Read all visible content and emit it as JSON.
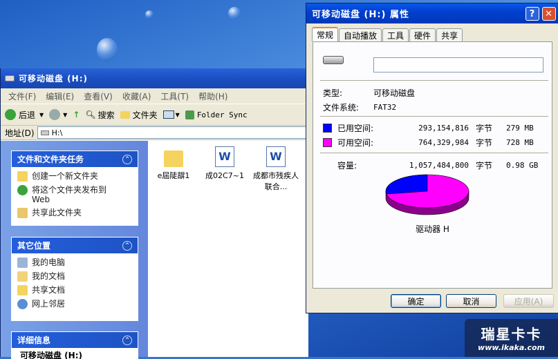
{
  "explorer": {
    "title": "可移动磁盘 (H:)",
    "menu": [
      "文件(F)",
      "编辑(E)",
      "查看(V)",
      "收藏(A)",
      "工具(T)",
      "帮助(H)"
    ],
    "toolbar": {
      "back": "后退",
      "search": "搜索",
      "folders": "文件夹",
      "sync": "Folder Sync"
    },
    "address_label": "地址(D)",
    "address_value": "H:\\",
    "tasks_panel": {
      "title": "文件和文件夹任务",
      "items": [
        "创建一个新文件夹",
        "将这个文件夹发布到",
        "Web",
        "共享此文件夹"
      ]
    },
    "other_panel": {
      "title": "其它位置",
      "items": [
        "我的电脑",
        "我的文档",
        "共享文档",
        "网上邻居"
      ]
    },
    "details_panel": {
      "title": "详细信息",
      "partial": "可移动磁盘 (H:)"
    },
    "files": [
      {
        "name": "e屆陡髜1",
        "icon": "folder-icon"
      },
      {
        "name": "成02C7~1",
        "icon": "word-doc-icon"
      },
      {
        "name": "成都市残疾人联合...",
        "icon": "word-doc-icon"
      }
    ]
  },
  "dialog": {
    "title": "可移动磁盘 (H:) 属性",
    "tabs": [
      "常规",
      "自动播放",
      "工具",
      "硬件",
      "共享"
    ],
    "volume_label": "",
    "type_label": "类型:",
    "type_value": "可移动磁盘",
    "fs_label": "文件系统:",
    "fs_value": "FAT32",
    "used": {
      "label": "已用空间:",
      "bytes": "293,154,816",
      "unit": "字节",
      "size": "279 MB",
      "color": "#0000ff"
    },
    "free": {
      "label": "可用空间:",
      "bytes": "764,329,984",
      "unit": "字节",
      "size": "728 MB",
      "color": "#ff00ff"
    },
    "capacity": {
      "label": "容量:",
      "bytes": "1,057,484,800",
      "unit": "字节",
      "size": "0.98 GB"
    },
    "drive_label": "驱动器 H",
    "buttons": {
      "ok": "确定",
      "cancel": "取消",
      "apply": "应用(A)"
    },
    "used_fraction": 0.277
  },
  "watermark": {
    "brand": "瑞星卡卡",
    "url": "www.ikaka.com"
  }
}
